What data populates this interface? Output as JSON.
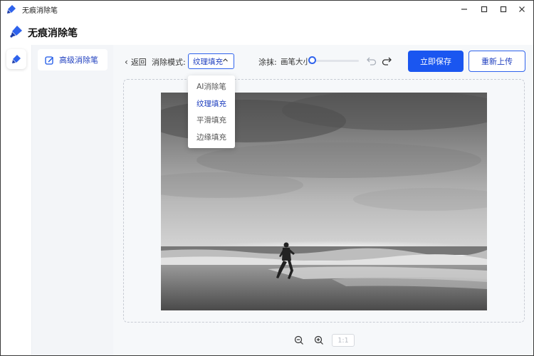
{
  "window": {
    "title": "无痕消除笔",
    "controls": [
      "minimize",
      "maximize",
      "close"
    ]
  },
  "header": {
    "app_name": "无痕消除笔"
  },
  "sidebar": {
    "items": [
      {
        "label": "高级消除笔",
        "icon": "edit-icon",
        "active": true
      }
    ]
  },
  "toolbar": {
    "back_label": "返回",
    "mode_label": "消除模式:",
    "mode_selected": "纹理填充",
    "smear_label": "涂抹:",
    "brush_size_label": "画笔大小",
    "brush_size": 0,
    "save_label": "立即保存",
    "reupload_label": "重新上传"
  },
  "mode_dropdown": {
    "options": [
      "AI消除笔",
      "纹理填充",
      "平滑填充",
      "边缘填充"
    ],
    "selected_index": 1
  },
  "zoombar": {
    "ratio_label": "1:1"
  },
  "colors": {
    "accent": "#1a56f0",
    "sidebar_bg": "#f3f5f8",
    "main_bg": "#f6f8fa"
  }
}
